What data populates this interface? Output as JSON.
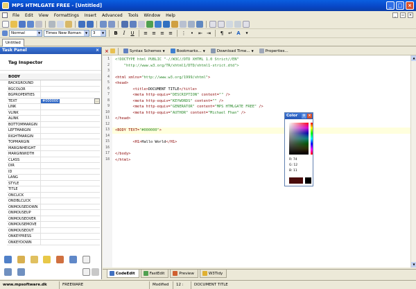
{
  "window": {
    "title": "MPS HTMLGATE FREE - [Untitled]"
  },
  "menu": [
    "File",
    "Edit",
    "View",
    "Formattings",
    "Insert",
    "Advanced",
    "Tools",
    "Window",
    "Help"
  ],
  "format_bar": {
    "style": "Normal",
    "font": "Times New Roman",
    "size": "3"
  },
  "doc_tab": "Untitled",
  "task_panel": {
    "header": "Task Panel",
    "title": "Tag Inspector",
    "section": "BODY",
    "properties": [
      {
        "name": "BACKGROUND",
        "value": ""
      },
      {
        "name": "BGCOLOR",
        "value": ""
      },
      {
        "name": "BGPROPERTIES",
        "value": ""
      },
      {
        "name": "TEXT",
        "value": "#000000"
      },
      {
        "name": "LINK",
        "value": ""
      },
      {
        "name": "VLINK",
        "value": ""
      },
      {
        "name": "ALINK",
        "value": ""
      },
      {
        "name": "BOTTOMMARGIN",
        "value": ""
      },
      {
        "name": "LEFTMARGIN",
        "value": ""
      },
      {
        "name": "RIGHTMARGIN",
        "value": ""
      },
      {
        "name": "TOPMARGIN",
        "value": ""
      },
      {
        "name": "MARGINHEIGHT",
        "value": ""
      },
      {
        "name": "MARGINWIDTH",
        "value": ""
      },
      {
        "name": "CLASS",
        "value": ""
      },
      {
        "name": "DIR",
        "value": ""
      },
      {
        "name": "ID",
        "value": ""
      },
      {
        "name": "LANG",
        "value": ""
      },
      {
        "name": "STYLE",
        "value": ""
      },
      {
        "name": "TITLE",
        "value": ""
      },
      {
        "name": "ONCLICK",
        "value": ""
      },
      {
        "name": "ONDBLCLICK",
        "value": ""
      },
      {
        "name": "ONMOUSEDOWN",
        "value": ""
      },
      {
        "name": "ONMOUSEUP",
        "value": ""
      },
      {
        "name": "ONMOUSEOVER",
        "value": ""
      },
      {
        "name": "ONMOUSEMOVE",
        "value": ""
      },
      {
        "name": "ONMOUSEOUT",
        "value": ""
      },
      {
        "name": "ONKEYPRESS",
        "value": ""
      },
      {
        "name": "ONKEYDOWN",
        "value": ""
      }
    ]
  },
  "editor_toolbar": {
    "syntax_schemes": "Syntax Schemes",
    "bookmarks": "Bookmarks...",
    "download_time": "Download Time...",
    "properties": "Properties..."
  },
  "code_lines": [
    "<!DOCTYPE html PUBLIC \"-//W3C//DTD XHTML 1.0 Strict//EN\"",
    "    \"http://www.w3.org/TR/xhtml1/DTD/xhtml1-strict.dtd\">",
    "",
    "<html xmlns=\"http://www.w3.org/1999/xhtml\">",
    "<head>",
    "        <title>DOCUMENT TITLE</title>",
    "        <meta http-equiv=\"DESCRIPTION\" content=\"\" />",
    "        <meta http-equiv=\"KEYWORDS\" content=\"\" />",
    "        <meta http-equiv=\"GENERATOR\" content=\"MPS HTMLGATE FREE\" />",
    "        <meta http-equiv=\"AUTHOR\" content=\"Michael Fhan\" />",
    "</head>",
    "",
    "<BODY TEXT=\"#000000\">",
    "",
    "        <H1>Hallo World</H1>",
    "",
    "</body>",
    "</html>"
  ],
  "line_numbers": [
    "1",
    "2",
    "3",
    "4",
    "5",
    "6",
    "7",
    "8",
    "9",
    "10",
    "11",
    "12",
    "13",
    "14",
    "15",
    "16",
    "17",
    "18"
  ],
  "color_popup": {
    "title": "Color",
    "r": "R: 74",
    "g": "G: 12",
    "b": "B: 11",
    "swatch": "#4A0C0B"
  },
  "bottom_tabs": [
    "CodeEdit",
    "FastEdit",
    "Preview",
    "W3Tidy"
  ],
  "status": {
    "site": "www.mpsoftware.dk",
    "license": "FREEWARE",
    "state": "Modified",
    "position": "12 : 22",
    "doc": "DOCUMENT TITLE"
  }
}
